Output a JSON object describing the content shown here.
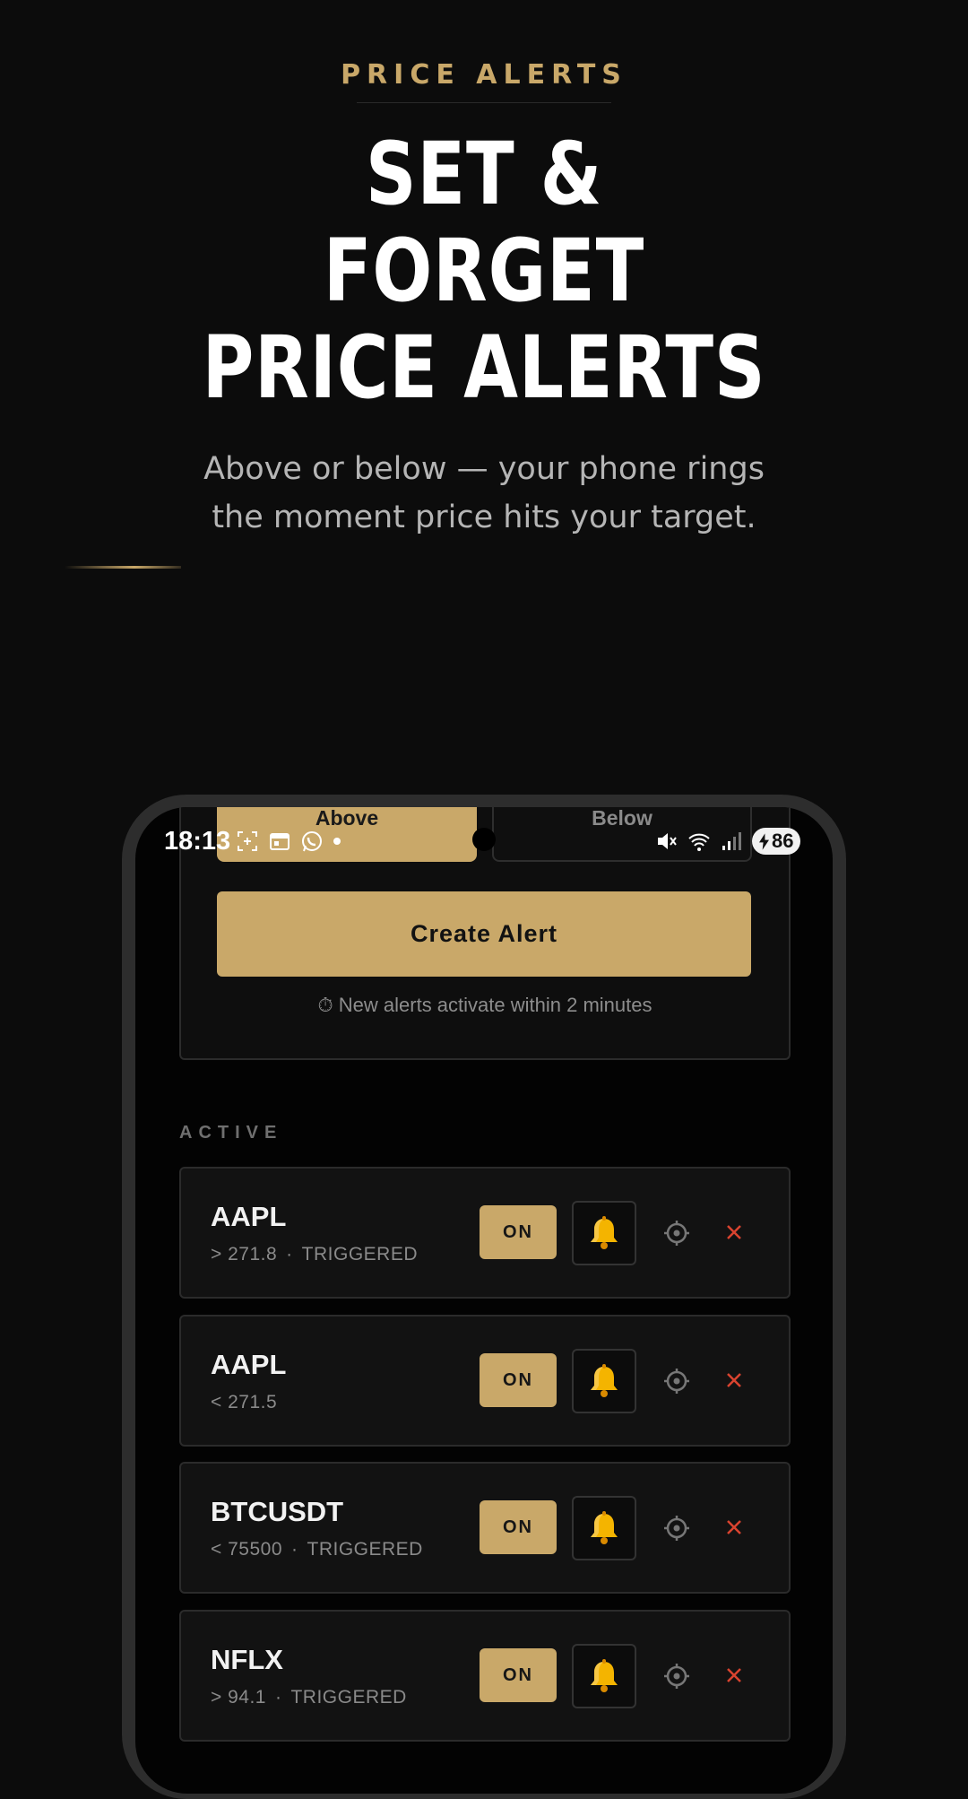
{
  "header": {
    "eyebrow": "PRICE ALERTS",
    "headline": [
      "SET &",
      "FORGET",
      "PRICE ALERTS"
    ],
    "subtitle": [
      "Above or below — your phone rings",
      "the moment price hits your target."
    ]
  },
  "status_bar": {
    "time": "18:13",
    "battery": "86"
  },
  "direction_toggle": {
    "above_label": "Above",
    "below_label": "Below",
    "selected": "Above"
  },
  "form": {
    "create_label": "Create Alert",
    "hint": "⏱ New alerts activate within 2 minutes"
  },
  "active_section": {
    "label": "ACTIVE",
    "alerts": [
      {
        "symbol": "AAPL",
        "condition": "> 271.8",
        "status": "TRIGGERED",
        "toggle": "ON"
      },
      {
        "symbol": "AAPL",
        "condition": "< 271.5",
        "status": "",
        "toggle": "ON"
      },
      {
        "symbol": "BTCUSDT",
        "condition": "< 75500",
        "status": "TRIGGERED",
        "toggle": "ON"
      },
      {
        "symbol": "NFLX",
        "condition": "> 94.1",
        "status": "TRIGGERED",
        "toggle": "ON"
      }
    ]
  },
  "colors": {
    "accent": "#c9a869",
    "background": "#0c0c0c",
    "delete": "#d9432f"
  },
  "icons": [
    "bell-icon",
    "target-icon",
    "close-icon",
    "mute-icon",
    "wifi-icon",
    "signal-icon",
    "bolt-icon"
  ]
}
